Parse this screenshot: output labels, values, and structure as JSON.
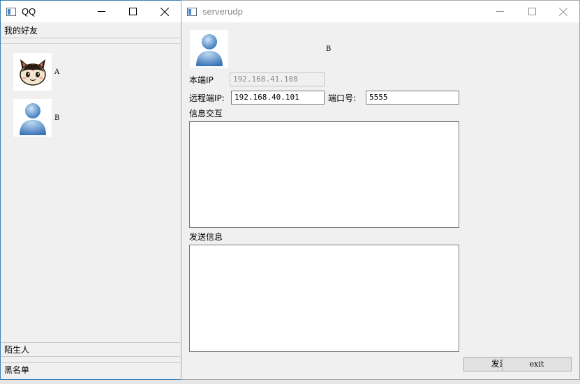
{
  "qq_window": {
    "title": "QQ",
    "sections": {
      "friends": "我的好友",
      "strangers": "陌生人",
      "blacklist": "黑名单"
    },
    "friends": [
      {
        "name": "A",
        "avatar": "cat-avatar-icon"
      },
      {
        "name": "B",
        "avatar": "user-avatar-icon"
      }
    ]
  },
  "server_window": {
    "title": "serverudp",
    "peer_name": "B",
    "avatar": "user-avatar-icon",
    "local_ip_label": "本端IP",
    "local_ip_value": "192.168.41.108",
    "remote_ip_label": "远程端IP:",
    "remote_ip_value": "192.168.40.101",
    "port_label": "端口号:",
    "port_value": "5555",
    "interaction_label": "信息交互",
    "send_info_label": "发送信息",
    "send_button": "发送",
    "exit_button": "exit"
  },
  "colors": {
    "qq_border": "#3c7fb1",
    "avatar_blue": "#4a87c8",
    "window_bg": "#f0f0f0"
  }
}
